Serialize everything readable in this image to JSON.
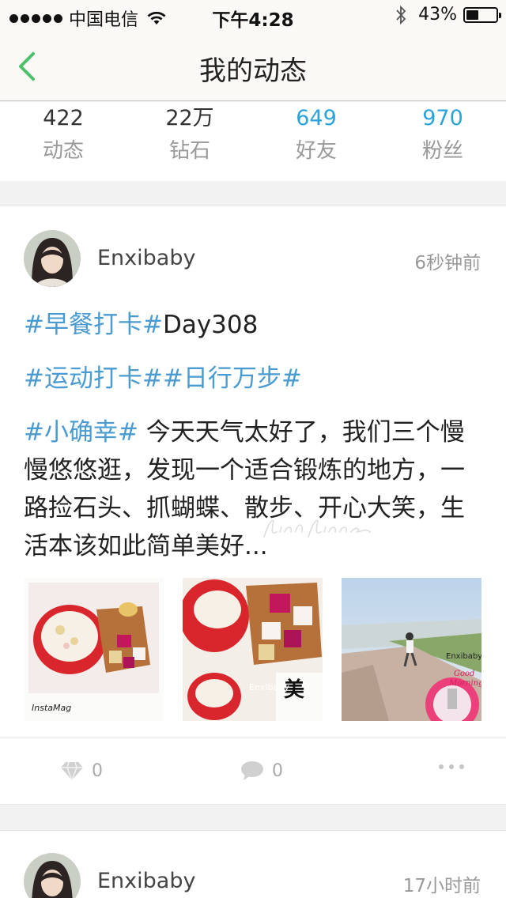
{
  "status_bar": {
    "carrier": "中国电信",
    "time": "下午4:28",
    "battery_percent": "43%",
    "battery_level": 0.43
  },
  "nav": {
    "title": "我的动态",
    "back_icon": "chevron-left-icon"
  },
  "stats": [
    {
      "value": "422",
      "label": "动态"
    },
    {
      "value": "22万",
      "label": "钻石"
    },
    {
      "value": "649",
      "label": "好友"
    },
    {
      "value": "970",
      "label": "粉丝"
    }
  ],
  "posts": [
    {
      "username": "Enxibaby",
      "time": "6秒钟前",
      "line1_topic": "#早餐打卡#",
      "line1_text": "Day308",
      "line2_topic": "#运动打卡##日行万步#",
      "line3_topic": "#小确幸#",
      "line3_text": "  今天天气太好了，我们三个慢慢悠悠逛，发现一个适合锻炼的地方，一路捡石头、抓蝴蝶、散步、开心大笑，生活本该如此简单美好...",
      "watermark": "LindaLinna",
      "diamond_count": "0",
      "comment_count": "0",
      "images": [
        {
          "name": "breakfast-bowl-image",
          "caption": "InstaMag"
        },
        {
          "name": "breakfast-closeup-image",
          "caption": "Enxibaby"
        },
        {
          "name": "walking-path-image",
          "caption": "Enxibaby",
          "caption2": "Good Morning"
        }
      ]
    },
    {
      "username": "Enxibaby",
      "time": "17小时前"
    }
  ],
  "colors": {
    "accent_green": "#4cc06a",
    "link_blue": "#2aa3dc",
    "topic_blue": "#4a9bd1"
  }
}
